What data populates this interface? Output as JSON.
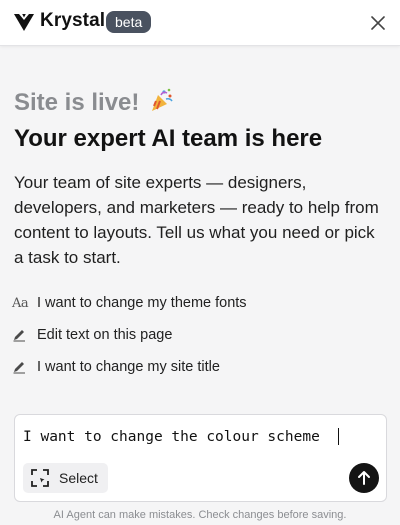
{
  "header": {
    "brand": "Krystal",
    "badge": "beta",
    "logo_icon": "krystal-logo-icon",
    "close_icon": "close-icon"
  },
  "hero": {
    "status_title": "Site is live!",
    "status_emoji": "party-popper-icon",
    "headline": "Your expert AI team is here",
    "intro": "Your team of site experts — designers, developers, and marketers — ready to help from content to layouts. Tell us what you need or pick a task to start."
  },
  "suggestions": [
    {
      "icon": "font-icon",
      "icon_text": "Aa",
      "label": "I want to change my theme fonts"
    },
    {
      "icon": "pencil-icon",
      "label": "Edit text on this page"
    },
    {
      "icon": "pencil-icon",
      "label": "I want to change my site title"
    }
  ],
  "composer": {
    "value": "I want to change the colour scheme",
    "select_label": "Select",
    "select_icon": "select-area-icon",
    "send_icon": "arrow-up-icon"
  },
  "disclaimer": "AI Agent can make mistakes. Check changes before saving.",
  "colors": {
    "badge_bg": "#4a5260",
    "send_bg": "#141414",
    "background": "#f5f5f6",
    "muted_title": "#8a8c90"
  }
}
